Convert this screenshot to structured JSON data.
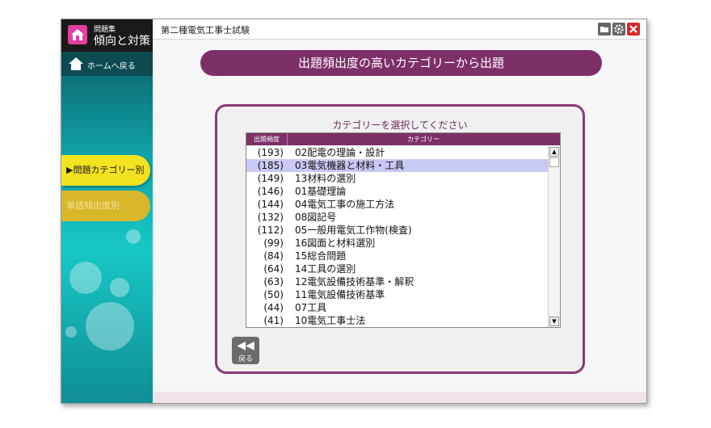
{
  "app": {
    "logo_small": "問題集",
    "logo_main": "傾向と対策",
    "window_title": "第二種電気工事士試験"
  },
  "sidebar": {
    "home_label": "ホームへ戻る",
    "items": [
      {
        "label": "▶問題カテゴリー別"
      },
      {
        "label": "単語頻出度別"
      }
    ]
  },
  "main": {
    "banner": "出題頻出度の高いカテゴリーから出題",
    "panel_title": "カテゴリーを選択してください",
    "col_freq": "出題頻度",
    "col_cat": "カテゴリー",
    "rows": [
      {
        "freq": "(193)",
        "name": "02配電の理論・設計"
      },
      {
        "freq": "(185)",
        "name": "03電気機器と材料・工具"
      },
      {
        "freq": "(149)",
        "name": "13材料の選別"
      },
      {
        "freq": "(146)",
        "name": "01基礎理論"
      },
      {
        "freq": "(144)",
        "name": "04電気工事の施工方法"
      },
      {
        "freq": "(132)",
        "name": "08図記号"
      },
      {
        "freq": "(112)",
        "name": "05一般用電気工作物(検査)"
      },
      {
        "freq": "(99)",
        "name": "16図面と材料選別"
      },
      {
        "freq": "(84)",
        "name": "15総合問題"
      },
      {
        "freq": "(64)",
        "name": "14工具の選別"
      },
      {
        "freq": "(63)",
        "name": "12電気設備技術基準・解釈"
      },
      {
        "freq": "(50)",
        "name": "11電気設備技術基準"
      },
      {
        "freq": "(44)",
        "name": "07工具"
      },
      {
        "freq": "(41)",
        "name": "10電気工事士法"
      }
    ],
    "selected_index": 1,
    "back_label": "戻る",
    "back_arrow": "◀◀"
  },
  "colors": {
    "accent": "#7d2f68",
    "selected_row": "#c9c9f5",
    "active_button": "#f3e21f"
  },
  "icons": {
    "logo": "house-icon",
    "home": "home-icon",
    "titlebar": [
      "folder-icon",
      "gear-icon",
      "close-icon"
    ]
  }
}
